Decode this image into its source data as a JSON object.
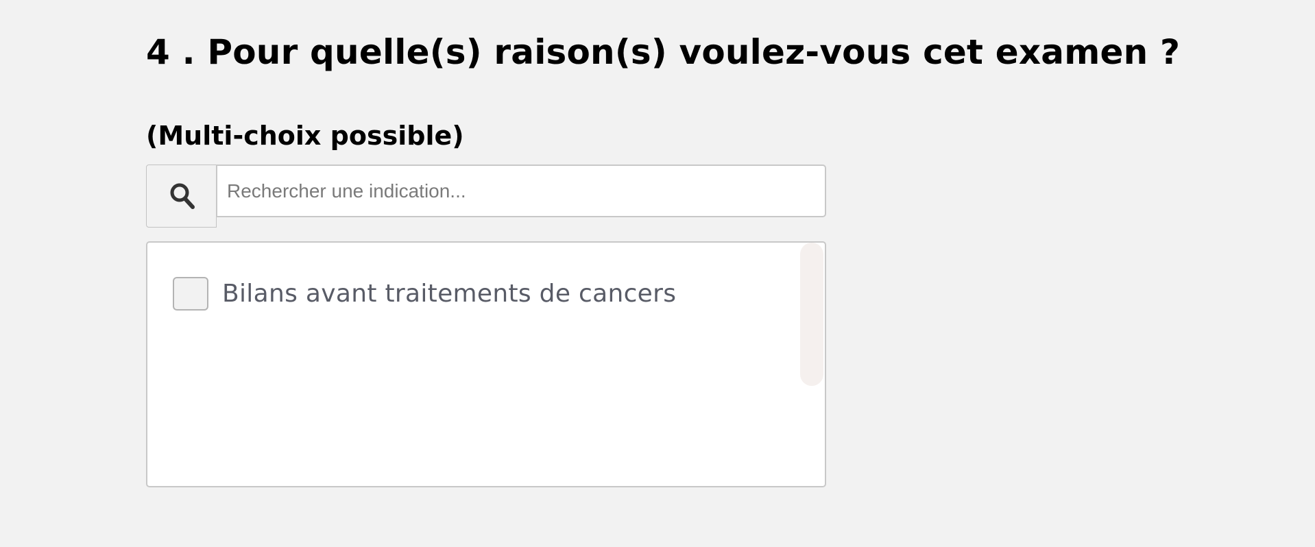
{
  "question": {
    "number": "4",
    "title": "4 . Pour quelle(s) raison(s) voulez-vous cet examen ?",
    "subtitle": "(Multi-choix possible)"
  },
  "search": {
    "icon": "search-icon",
    "placeholder": "Rechercher une indication...",
    "value": ""
  },
  "options": [
    {
      "label": "Bilans avant traitements de cancers",
      "checked": false
    }
  ],
  "scrollbar": {
    "visible": true
  },
  "colors": {
    "page_background": "#f2f2f2",
    "panel_background": "#ffffff",
    "border": "#c8c8c8",
    "title_text": "#000000",
    "option_text": "#585b66",
    "placeholder_text": "#7a7a7a",
    "scrollbar_thumb": "#f5f0ee"
  }
}
